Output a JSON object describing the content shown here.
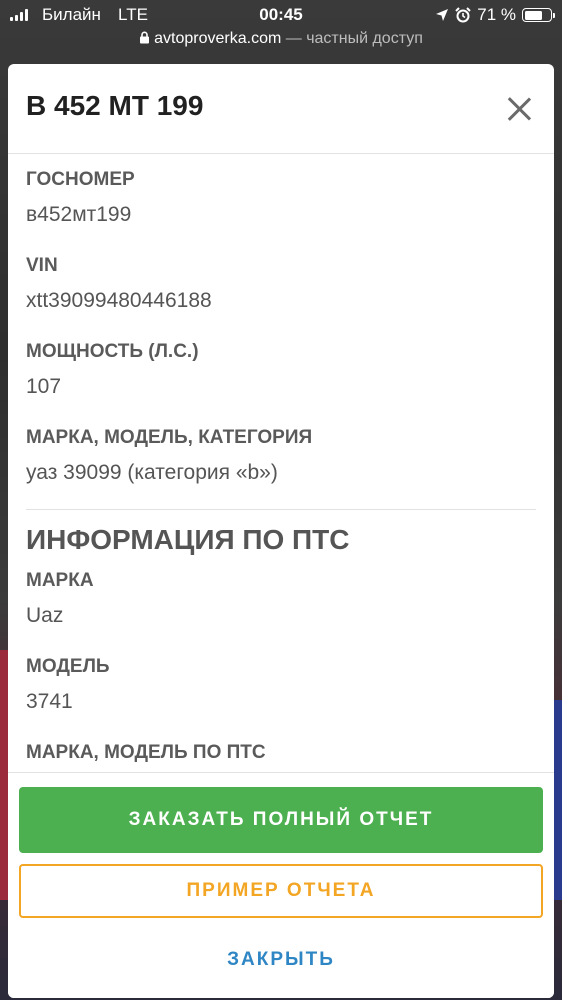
{
  "status_bar": {
    "carrier": "Билайн",
    "network": "LTE",
    "time": "00:45",
    "battery": "71 %",
    "battery_level": 0.71,
    "icons": [
      "signal-icon",
      "location-arrow-icon",
      "alarm-icon",
      "battery-icon"
    ]
  },
  "url_bar": {
    "domain": "avtoproverka.com",
    "separator": " — ",
    "suffix": "частный доступ",
    "icon": "lock-icon"
  },
  "modal": {
    "title": "В 452 МТ 199",
    "close_icon": "close-icon",
    "fields": [
      {
        "label": "ГОСНОМЕР",
        "value": "в452мт199"
      },
      {
        "label": "VIN",
        "value": "xtt39099480446188"
      },
      {
        "label": "МОЩНОСТЬ (Л.С.)",
        "value": "107"
      },
      {
        "label": "МАРКА, МОДЕЛЬ, КАТЕГОРИЯ",
        "value": "уаз 39099 (категория «b»)"
      }
    ],
    "pts_section": {
      "title": "ИНФОРМАЦИЯ ПО ПТС",
      "fields": [
        {
          "label": "МАРКА",
          "value": "Uaz"
        },
        {
          "label": "МОДЕЛЬ",
          "value": "3741"
        },
        {
          "label": "МАРКА, МОДЕЛЬ ПО ПТС",
          "value": ""
        }
      ]
    },
    "footer": {
      "order_button": "ЗАКАЗАТЬ ПОЛНЫЙ ОТЧЕТ",
      "sample_button": "ПРИМЕР ОТЧЕТА",
      "close_button": "ЗАКРЫТЬ"
    }
  },
  "colors": {
    "primary_green": "#4caf50",
    "accent_orange": "#f3a524",
    "link_blue": "#2f86c4"
  }
}
